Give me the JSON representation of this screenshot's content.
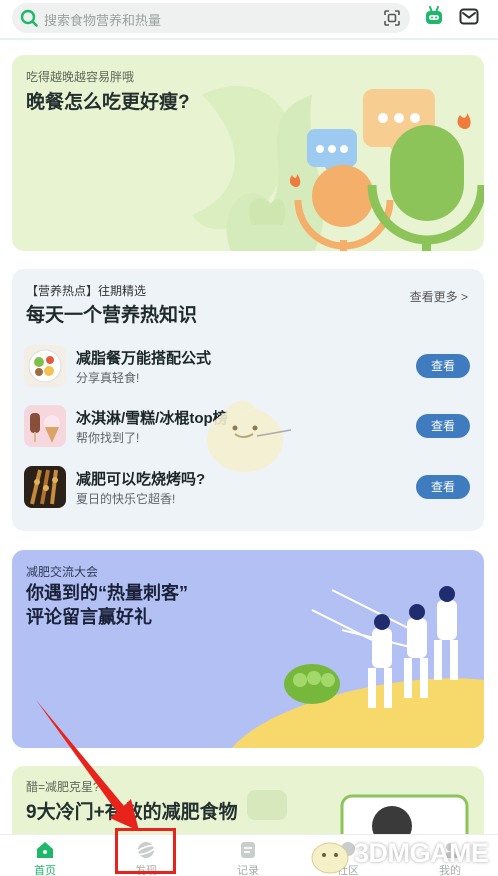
{
  "search": {
    "placeholder": "搜索食物营养和热量"
  },
  "banner1": {
    "small": "吃得越晚越容易胖哦",
    "title": "晚餐怎么吃更好瘦?"
  },
  "hot": {
    "tag": "【营养热点】往期精选",
    "title": "每天一个营养热知识",
    "more": "查看更多 >",
    "items": [
      {
        "name": "减脂餐万能搭配公式",
        "sub": "分享真轻食!",
        "button": "查看"
      },
      {
        "name": "冰淇淋/雪糕/冰棍top榜",
        "sub": "帮你找到了!",
        "button": "查看"
      },
      {
        "name": "减肥可以吃烧烤吗?",
        "sub": "夏日的快乐它超香!",
        "button": "查看"
      }
    ]
  },
  "banner3": {
    "small": "减肥交流大会",
    "title_line1": "你遇到的“热量刺客”",
    "title_line2": "评论留言赢好礼"
  },
  "banner4": {
    "small": "醋=减肥克星?",
    "title": "9大冷门+有效的减肥食物"
  },
  "tabs": [
    {
      "label": "首页",
      "active": true
    },
    {
      "label": "发现",
      "active": false
    },
    {
      "label": "记录",
      "active": false
    },
    {
      "label": "社区",
      "active": false
    },
    {
      "label": "我的",
      "active": false
    }
  ],
  "watermark": "3DMGAME",
  "colors": {
    "accent": "#1db86a",
    "button": "#3f7cbf",
    "highlight": "#e8231c"
  },
  "icons": [
    "search-icon",
    "scan-icon",
    "robot-icon",
    "mail-icon",
    "home-icon",
    "discover-icon",
    "record-icon",
    "community-icon",
    "profile-icon"
  ]
}
